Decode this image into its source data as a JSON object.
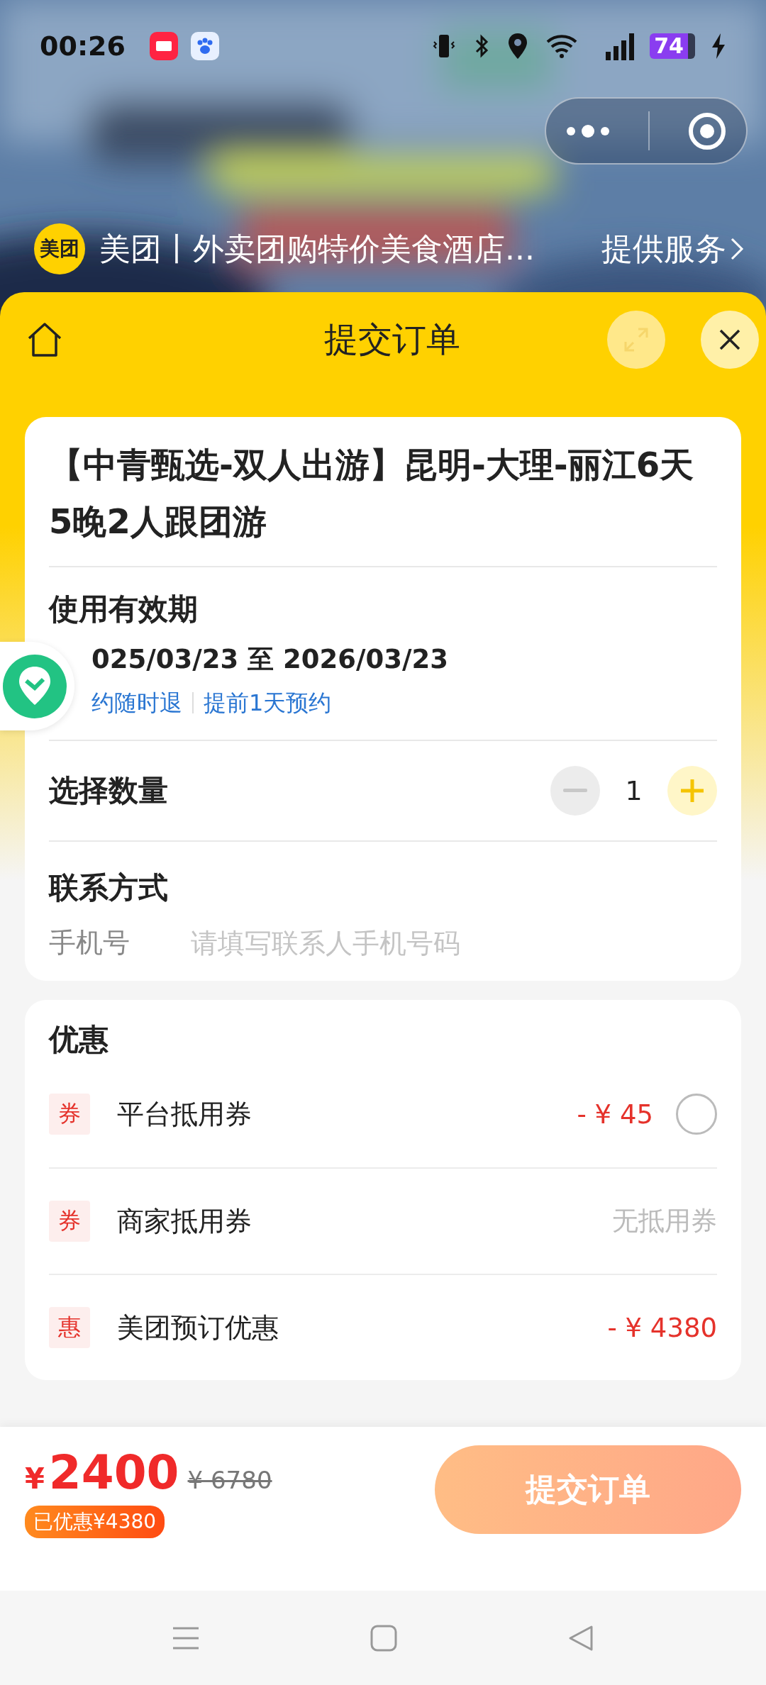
{
  "status_bar": {
    "time": "00:26",
    "battery": "74"
  },
  "mini_program": {
    "logo_text": "美团",
    "title": "美团丨外卖团购特价美食酒店...",
    "service_link": "提供服务"
  },
  "sheet": {
    "title": "提交订单"
  },
  "product": {
    "title": "【中青甄选-双人出游】昆明-大理-丽江6天5晚2人跟团游",
    "validity_label": "使用有效期",
    "validity_dates": "025/03/23 至 2026/03/23",
    "tags": [
      "约随时退",
      "提前1天预约"
    ]
  },
  "quantity": {
    "label": "选择数量",
    "value": "1",
    "minus_disabled": true
  },
  "contact": {
    "label": "联系方式",
    "field_label": "手机号",
    "placeholder": "请填写联系人手机号码"
  },
  "discounts": {
    "title": "优惠",
    "items": [
      {
        "badge": "券",
        "label": "平台抵用券",
        "value": "- ¥ 45",
        "kind": "selectable",
        "selected": false
      },
      {
        "badge": "券",
        "label": "商家抵用券",
        "value": "无抵用券",
        "kind": "none"
      },
      {
        "badge": "惠",
        "label": "美团预订优惠",
        "value": "- ¥ 4380",
        "kind": "applied"
      }
    ]
  },
  "footer": {
    "currency": "¥",
    "price": "2400",
    "original_price": "¥ 6780",
    "saved_badge": "已优惠¥4380",
    "submit": "提交订单"
  }
}
